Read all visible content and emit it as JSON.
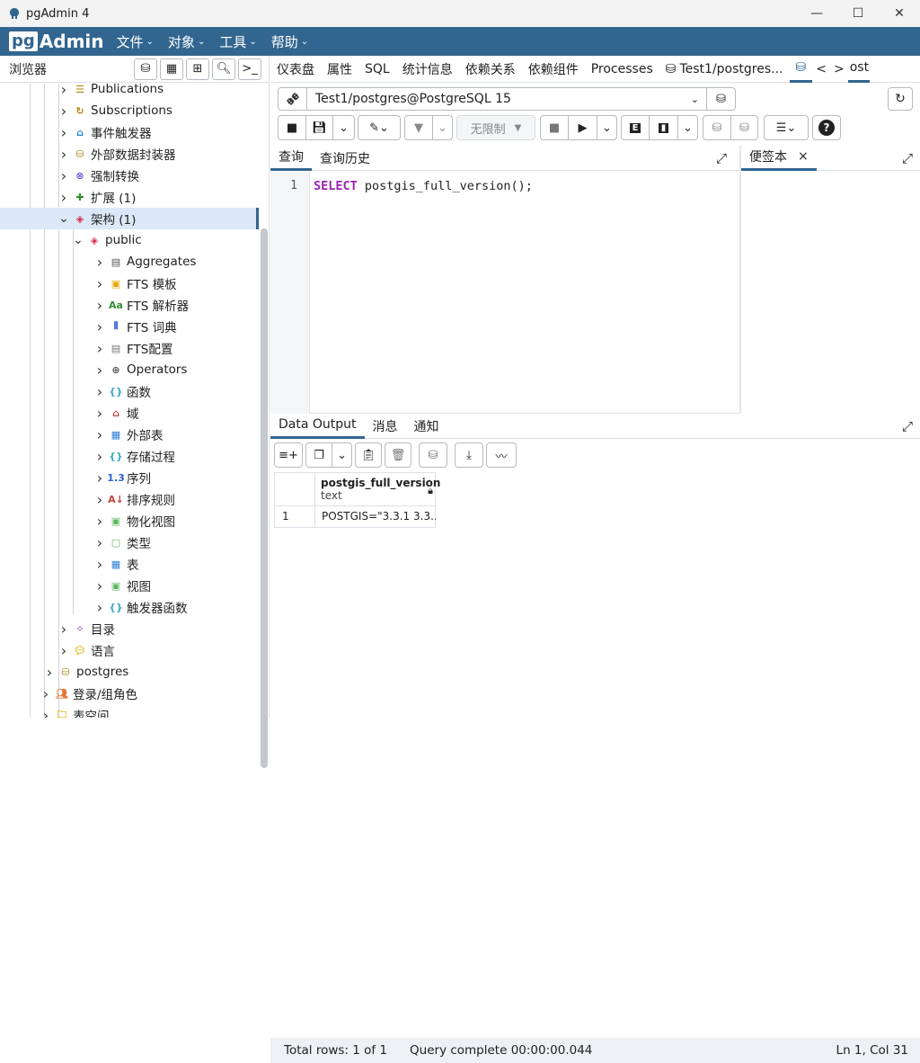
{
  "window": {
    "title": "pgAdmin 4",
    "minimize": "—",
    "maximize": "☐",
    "close": "✕"
  },
  "menubar": {
    "logo_pg": "pg",
    "logo_admin": "Admin",
    "items": [
      "文件",
      "对象",
      "工具",
      "帮助"
    ]
  },
  "browser": {
    "label": "浏览器"
  },
  "tree": [
    {
      "label": "Publications",
      "depth": 2,
      "icon": "publication-icon"
    },
    {
      "label": "Subscriptions",
      "depth": 2,
      "icon": "subscription-icon"
    },
    {
      "label": "事件触发器",
      "depth": 2,
      "icon": "event-trigger-icon"
    },
    {
      "label": "外部数据封装器",
      "depth": 2,
      "icon": "fdw-icon"
    },
    {
      "label": "强制转换",
      "depth": 2,
      "icon": "cast-icon"
    },
    {
      "label": "扩展 (1)",
      "depth": 2,
      "icon": "extension-icon"
    },
    {
      "label": "架构 (1)",
      "depth": 2,
      "icon": "schema-icon",
      "expanded": true,
      "selected": true
    },
    {
      "label": "public",
      "depth": 3,
      "icon": "public-schema-icon",
      "expanded": true
    },
    {
      "label": "Aggregates",
      "depth": 4,
      "icon": "aggregate-icon"
    },
    {
      "label": "FTS 模板",
      "depth": 4,
      "icon": "fts-template-icon"
    },
    {
      "label": "FTS 解析器",
      "depth": 4,
      "icon": "fts-parser-icon"
    },
    {
      "label": "FTS 词典",
      "depth": 4,
      "icon": "fts-dictionary-icon"
    },
    {
      "label": "FTS配置",
      "depth": 4,
      "icon": "fts-config-icon"
    },
    {
      "label": "Operators",
      "depth": 4,
      "icon": "operator-icon"
    },
    {
      "label": "函数",
      "depth": 4,
      "icon": "function-icon"
    },
    {
      "label": "域",
      "depth": 4,
      "icon": "domain-icon"
    },
    {
      "label": "外部表",
      "depth": 4,
      "icon": "foreign-table-icon"
    },
    {
      "label": "存储过程",
      "depth": 4,
      "icon": "procedure-icon"
    },
    {
      "label": "序列",
      "depth": 4,
      "icon": "sequence-icon"
    },
    {
      "label": "排序规则",
      "depth": 4,
      "icon": "collation-icon"
    },
    {
      "label": "物化视图",
      "depth": 4,
      "icon": "materialized-view-icon"
    },
    {
      "label": "类型",
      "depth": 4,
      "icon": "type-icon"
    },
    {
      "label": "表",
      "depth": 4,
      "icon": "table-icon"
    },
    {
      "label": "视图",
      "depth": 4,
      "icon": "view-icon"
    },
    {
      "label": "触发器函数",
      "depth": 4,
      "icon": "trigger-function-icon"
    },
    {
      "label": "目录",
      "depth": 2,
      "icon": "catalog-icon"
    },
    {
      "label": "语言",
      "depth": 2,
      "icon": "language-icon"
    },
    {
      "label": "postgres",
      "depth": 1,
      "icon": "database-icon"
    },
    {
      "label": "登录/组角色",
      "depth": 0,
      "icon": "login-role-icon"
    },
    {
      "label": "表空间",
      "depth": 0,
      "icon": "tablespace-icon"
    }
  ],
  "tabs": [
    "仪表盘",
    "属性",
    "SQL",
    "统计信息",
    "依赖关系",
    "依赖组件",
    "Processes",
    "Test1/postgres..."
  ],
  "tab_overflow": "ostg",
  "connection": "Test1/postgres@PostgreSQL 15",
  "toolbar": {
    "limit": "无限制"
  },
  "editor": {
    "tabs": [
      "查询",
      "查询历史"
    ],
    "line": "1",
    "keyword": "SELECT",
    "rest": " postgis_full_version();"
  },
  "scratch": {
    "tab": "便签本",
    "close": "×"
  },
  "output": {
    "tabs": [
      "Data Output",
      "消息",
      "通知"
    ],
    "column": {
      "name": "postgis_full_version",
      "type": "text"
    },
    "rows": [
      {
        "num": "1",
        "value": "POSTGIS=\"3.3.1 3.3..."
      }
    ]
  },
  "status": {
    "total": "Total rows: 1 of 1",
    "query": "Query complete 00:00:00.044",
    "position": "Ln 1, Col 31"
  }
}
